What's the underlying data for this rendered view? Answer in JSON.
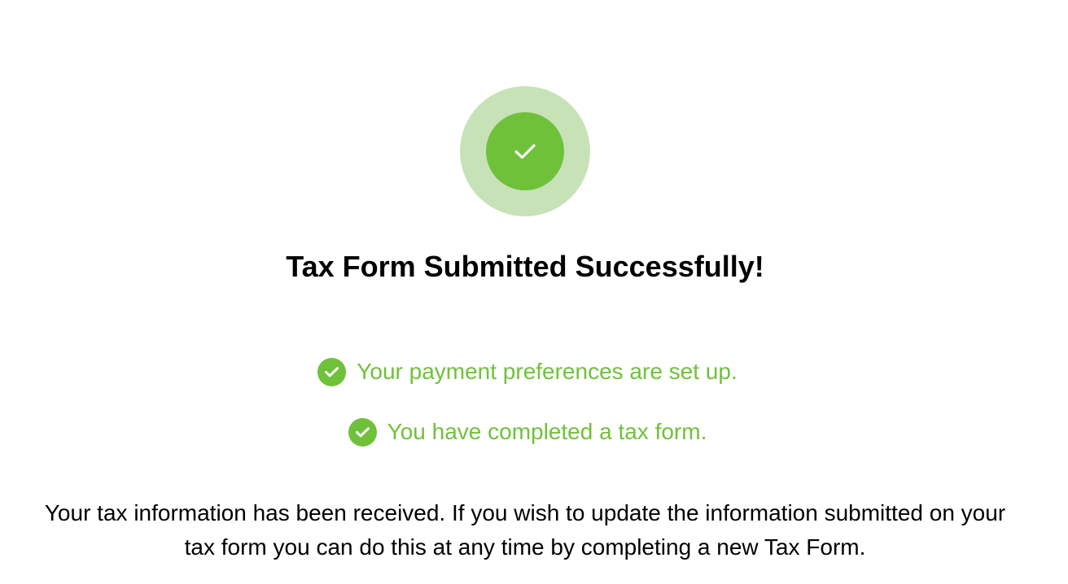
{
  "success_icon": "checkmark-icon",
  "colors": {
    "accent": "#70c13a",
    "accent_light": "#c8e2b8",
    "text": "#000000",
    "background": "#ffffff"
  },
  "title": "Tax Form Submitted Successfully!",
  "status_items": [
    {
      "icon": "check-circle-icon",
      "text": "Your payment preferences are set up."
    },
    {
      "icon": "check-circle-icon",
      "text": "You have completed a tax form."
    }
  ],
  "message": "Your tax information has been received. If you wish to update the information submitted on your tax form you can do this at any time by completing a new Tax Form."
}
